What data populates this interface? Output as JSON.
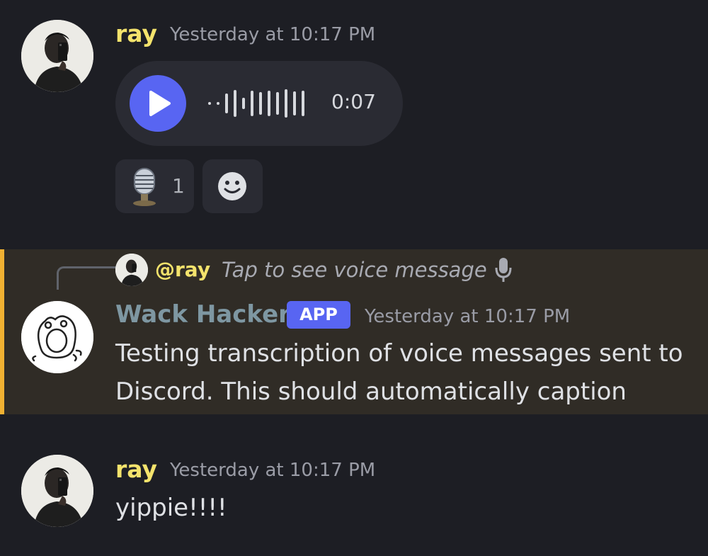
{
  "messages": [
    {
      "author": "ray",
      "timestamp": "Yesterday at 10:17 PM",
      "voice": {
        "duration": "0:07"
      },
      "reactions": [
        {
          "icon": "microphone-emoji",
          "count": "1"
        },
        {
          "icon": "add-reaction-smiley-icon"
        }
      ]
    },
    {
      "reply": {
        "user": "@ray",
        "text": "Tap to see voice message",
        "icon": "microphone-icon"
      },
      "author": "Wack Hacker",
      "badge": "APP",
      "timestamp": "Yesterday at 10:17 PM",
      "lines": [
        "Testing transcription of voice messages sent to",
        "Discord. This should automatically caption"
      ]
    },
    {
      "author": "ray",
      "timestamp": "Yesterday at 10:17 PM",
      "text": "yippie!!!!"
    }
  ],
  "colors": {
    "accent": "#5865f2",
    "mention_highlight": "#302c26",
    "mention_bar": "#f0b132",
    "ray_name": "#f4e36c"
  }
}
